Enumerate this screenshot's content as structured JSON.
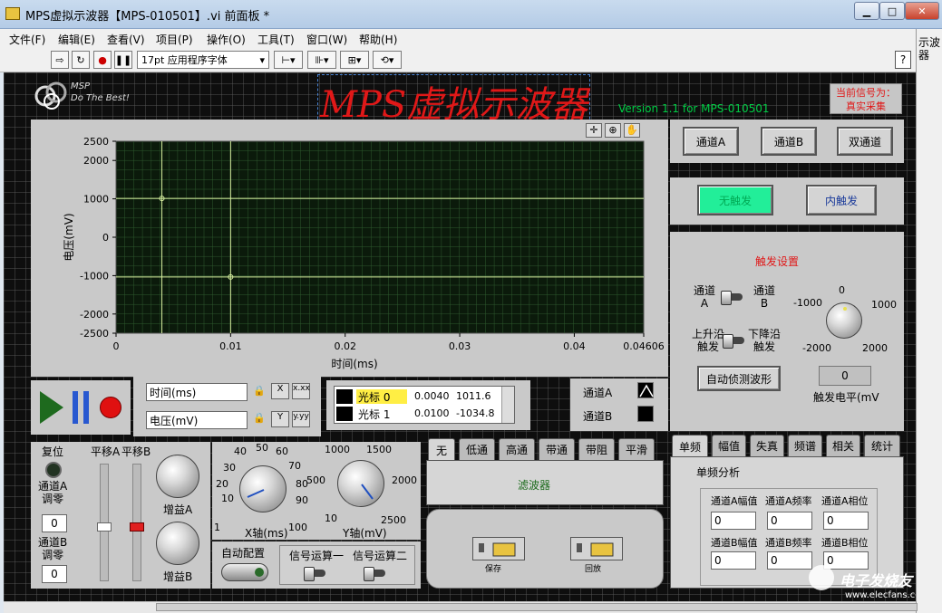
{
  "window": {
    "title": "MPS虚拟示波器【MPS-010501】.vi 前面板 *",
    "right_label": "示波器"
  },
  "menu": [
    "文件(F)",
    "编辑(E)",
    "查看(V)",
    "项目(P)",
    "操作(O)",
    "工具(T)",
    "窗口(W)",
    "帮助(H)"
  ],
  "toolbar": {
    "font": "17pt 应用程序字体",
    "help": "?"
  },
  "header": {
    "logo_line1": "MSP",
    "logo_line2": "Do The Best!",
    "title": "MPS虚拟示波器",
    "version": "Version 1.1 for MPS-010501",
    "status": "当前信号为：\n真实采集"
  },
  "chart_data": {
    "type": "line",
    "xlabel": "时间(ms)",
    "ylabel": "电压(mV)",
    "xlim": [
      0,
      0.04606
    ],
    "ylim": [
      -2500,
      2500
    ],
    "x_ticks": [
      "0",
      "0.01",
      "0.02",
      "0.03",
      "0.04",
      "0.04606"
    ],
    "y_ticks": [
      "2500",
      "2000",
      "1000",
      "0",
      "-1000",
      "-2000",
      "-2500"
    ],
    "cursors": [
      {
        "x": 0.004,
        "y": 1011.6
      },
      {
        "x": 0.01,
        "y": -1034.8
      }
    ],
    "grid": true
  },
  "axis_controls": {
    "x_name": "时间(ms)",
    "y_name": "电压(mV)"
  },
  "cursor_table": [
    {
      "name": "光标 0",
      "x": "0.0040",
      "y": "1011.6"
    },
    {
      "name": "光标 1",
      "x": "0.0100",
      "y": "-1034.8"
    }
  ],
  "channel_legend": {
    "a": "通道A",
    "b": "通道B"
  },
  "channel_buttons": {
    "a": "通道A",
    "b": "通道B",
    "both": "双通道"
  },
  "trigger_mode": {
    "none": "无触发",
    "internal": "内触发"
  },
  "trigger": {
    "title": "触发设置",
    "ch_a": "通道\nA",
    "ch_b": "通道\nB",
    "rise": "上升沿\n触发",
    "fall": "下降沿\n触发",
    "auto": "自动侦测波形",
    "level_label": "触发电平(mV",
    "level": "0",
    "knob_ticks": {
      "top": "0",
      "left": "-1000",
      "right": "1000",
      "bl": "-2000",
      "br": "2000"
    }
  },
  "left_controls": {
    "reset": "复位",
    "ch_a_zero": "通道A\n调零",
    "ch_a_val": "0",
    "ch_b_zero": "通道B\n调零",
    "ch_b_val": "0",
    "shift_a": "平移A",
    "shift_b": "平移B",
    "gain_a": "增益A",
    "gain_b": "增益B"
  },
  "x_knob": {
    "label": "X轴(ms)",
    "ticks": [
      "1",
      "10",
      "20",
      "30",
      "40",
      "50",
      "60",
      "70",
      "80",
      "90",
      "100"
    ]
  },
  "y_knob": {
    "label": "Y轴(mV)",
    "ticks": [
      "10",
      "500",
      "1000",
      "1500",
      "2000",
      "2500"
    ]
  },
  "auto_config": "自动配置",
  "ops": {
    "op1": "信号运算一",
    "op2": "信号运算二"
  },
  "filter_tabs": [
    "无",
    "低通",
    "高通",
    "带通",
    "带阻",
    "平滑"
  ],
  "filter_label": "滤波器",
  "file_buttons": {
    "save": "保存",
    "load": "回放"
  },
  "analysis_tabs": [
    "单频",
    "幅值",
    "失真",
    "频谱",
    "相关",
    "统计"
  ],
  "analysis": {
    "title": "单频分析",
    "fields": [
      {
        "label": "通道A幅值",
        "value": "0"
      },
      {
        "label": "通道A频率",
        "value": "0"
      },
      {
        "label": "通道A相位",
        "value": "0"
      },
      {
        "label": "通道B幅值",
        "value": "0"
      },
      {
        "label": "通道B频率",
        "value": "0"
      },
      {
        "label": "通道B相位",
        "value": "0"
      }
    ]
  },
  "watermark": {
    "text": "电子发烧友",
    "url": "www.elecfans.com"
  },
  "colors": {
    "plot_bg": "#0b1a0b",
    "grid": "#2f5a2f",
    "cursor": "#d8f0a0",
    "title_red": "#e01818",
    "version_green": "#00cc44",
    "active_btn": "#22ee99"
  }
}
